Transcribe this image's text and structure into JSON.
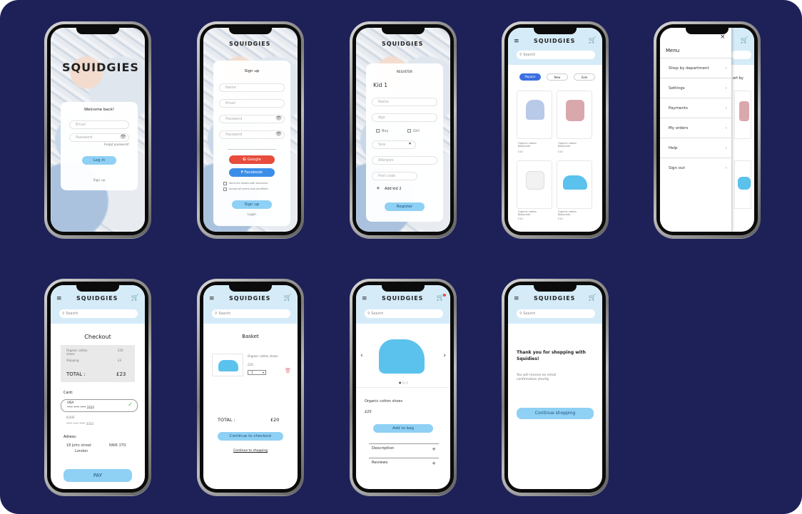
{
  "colors": {
    "background": "#1e2157",
    "accent": "#8fd0f5",
    "header": "#d5ecf8",
    "google": "#e74c3c",
    "facebook": "#3b8ee8"
  },
  "brand": "SQUIDGIES",
  "login": {
    "title": "Welcome back!",
    "email_placeholder": "Email",
    "password_placeholder": "Password",
    "forgot": "Forgot password?",
    "login_button": "Log in",
    "signup_link": "Sign up"
  },
  "signup": {
    "title": "Sign up",
    "name_placeholder": "Name",
    "email_placeholder": "Email",
    "password_placeholder": "Password",
    "confirm_placeholder": "Password",
    "google": "Google",
    "facebook": "Facebook",
    "check1": "Send me emails with discounts",
    "check2": "Accept all terms and conditions",
    "signup_button": "Sign up",
    "login_link": "Login"
  },
  "register": {
    "title": "REGISTER",
    "kid": "Kid 1",
    "name": "Name",
    "age": "Age",
    "boy": "Boy",
    "girl": "Girl",
    "size": "Size",
    "allergies": "Allergies",
    "postcode": "Post code",
    "add_kid": "Add kid 2",
    "register_button": "Register"
  },
  "shop": {
    "search": "Search",
    "tabs": [
      "Popular",
      "New",
      "Sale"
    ],
    "products": [
      {
        "name": "Organic cotton Babysuits",
        "price": "£10"
      },
      {
        "name": "Organic cotton Babysuits",
        "price": "£10"
      },
      {
        "name": "Organic cotton Babysuits",
        "price": "£10"
      },
      {
        "name": "Organic cotton Babysuits",
        "price": "£10"
      }
    ]
  },
  "menu": {
    "title": "Menu",
    "items": [
      "Shop by department",
      "Settings",
      "Payments",
      "My orders",
      "Help",
      "Sign out"
    ],
    "peek": "ort by"
  },
  "checkout": {
    "title": "Checkout",
    "item1": "Organic cotton shoes",
    "item1_price": "£20",
    "shipping": "Shipping",
    "shipping_price": "£3",
    "total_label": "TOTAL :",
    "total": "£23",
    "card_label": "Card:",
    "card_type": "VISA",
    "card_number": "**** **** **** 2222",
    "card_type2": "ILOVE",
    "card_number2": "**** **** **** 3333",
    "address_label": "Adress:",
    "address_street": "18 John street",
    "address_city": "London",
    "postcode": "NW6 1TO",
    "pay": "PAY"
  },
  "basket": {
    "title": "Basket",
    "item": "Organic cotton shoes",
    "price": "£20",
    "qty": "1",
    "total_label": "TOTAL :",
    "total": "£20",
    "checkout_button": "Continue to checkout",
    "shopping_link": "Continue to shopping"
  },
  "product": {
    "name": "Organic cotton shoes",
    "price": "£20",
    "add_button": "Add to bag",
    "description": "Description",
    "reviews": "Reviews"
  },
  "thanks": {
    "title": "Thank you for shopping with Squidies!",
    "body": "You will receive an email confirmation shortly.",
    "button": "Continue shopping"
  }
}
